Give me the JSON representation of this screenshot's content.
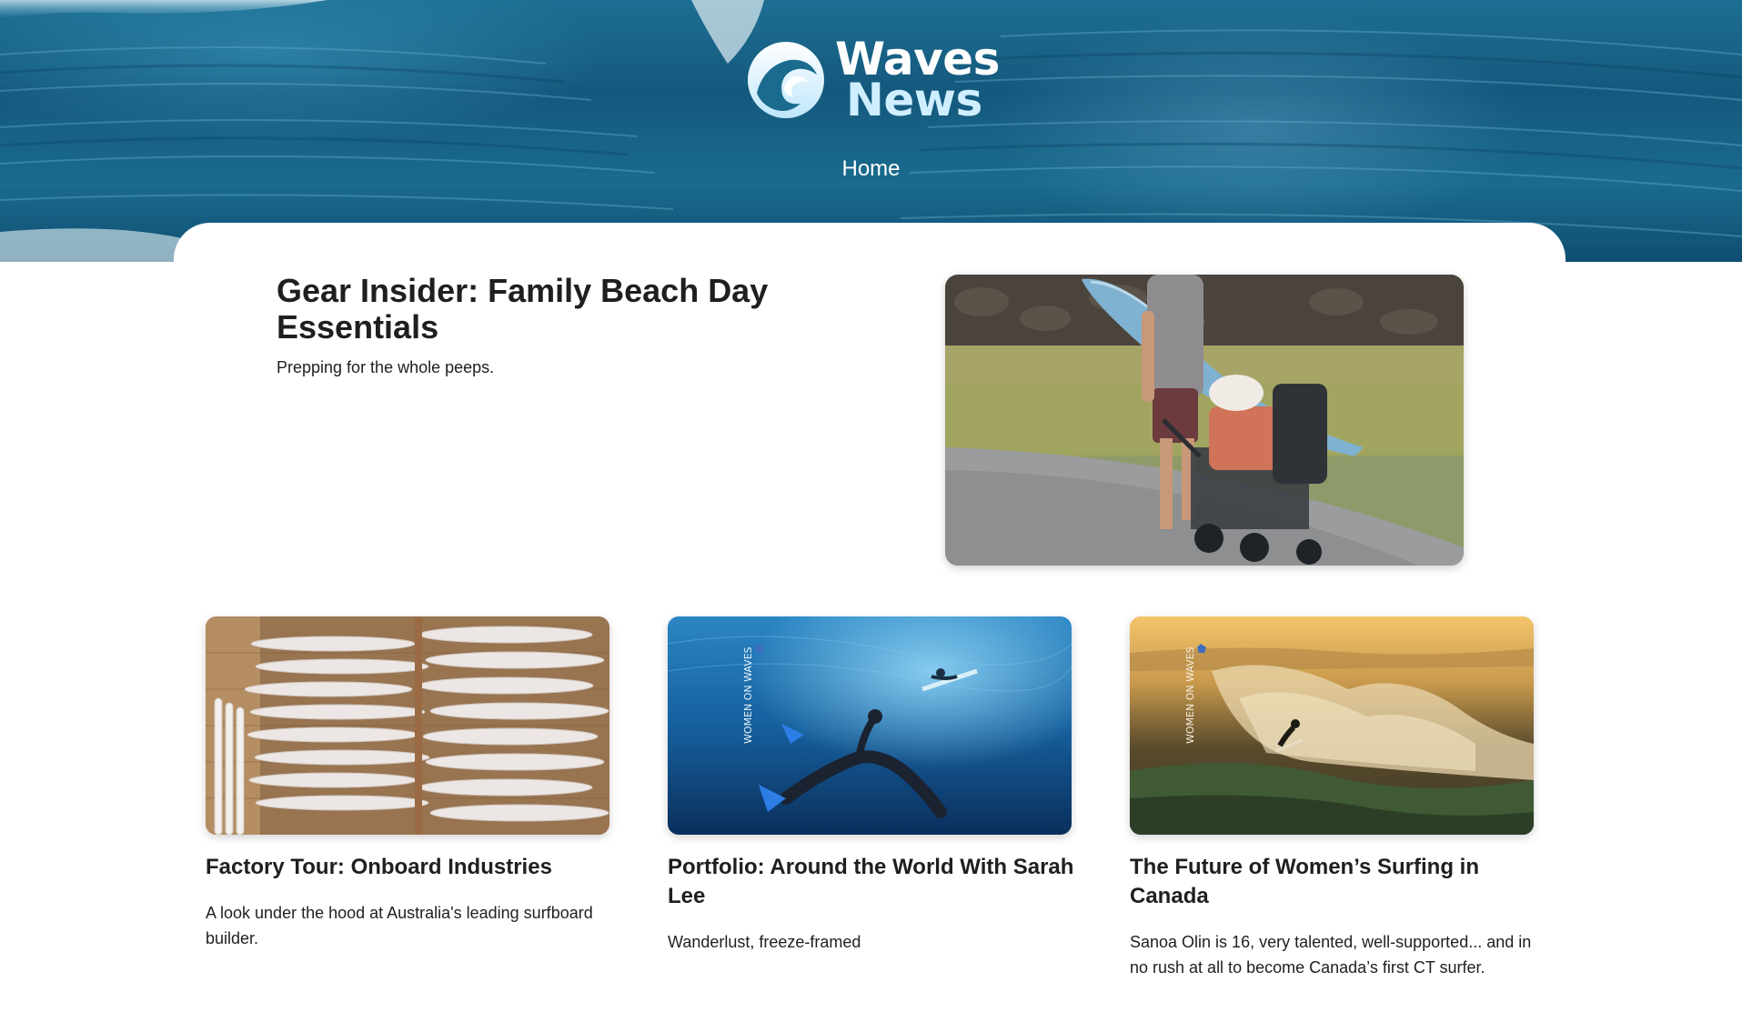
{
  "brand": {
    "name_line1": "Waves",
    "name_line2": "News",
    "logo_icon": "wave-circle-icon"
  },
  "nav": {
    "items": [
      {
        "label": "Home"
      }
    ]
  },
  "featured": {
    "title": "Gear Insider: Family Beach Day Essentials",
    "subtitle": "Prepping for the whole peeps."
  },
  "articles": [
    {
      "title": "Factory Tour: Onboard Industries",
      "description": "A look under the hood at Australia's leading surfboard builder."
    },
    {
      "title": "Portfolio: Around the World With Sarah Lee",
      "description": "Wanderlust, freeze-framed",
      "badge": "WOMEN ON WAVES"
    },
    {
      "title": "The Future of Women’s Surfing in Canada",
      "description": "Sanoa Olin is 16, very talented, well-supported... and in no rush at all to become Canada’s first CT surfer.",
      "badge": "WOMEN ON WAVES"
    }
  ],
  "colors": {
    "hero_blue": "#1a6b8e",
    "logo_light": "#cfeeff",
    "text": "#1f1f1f"
  }
}
